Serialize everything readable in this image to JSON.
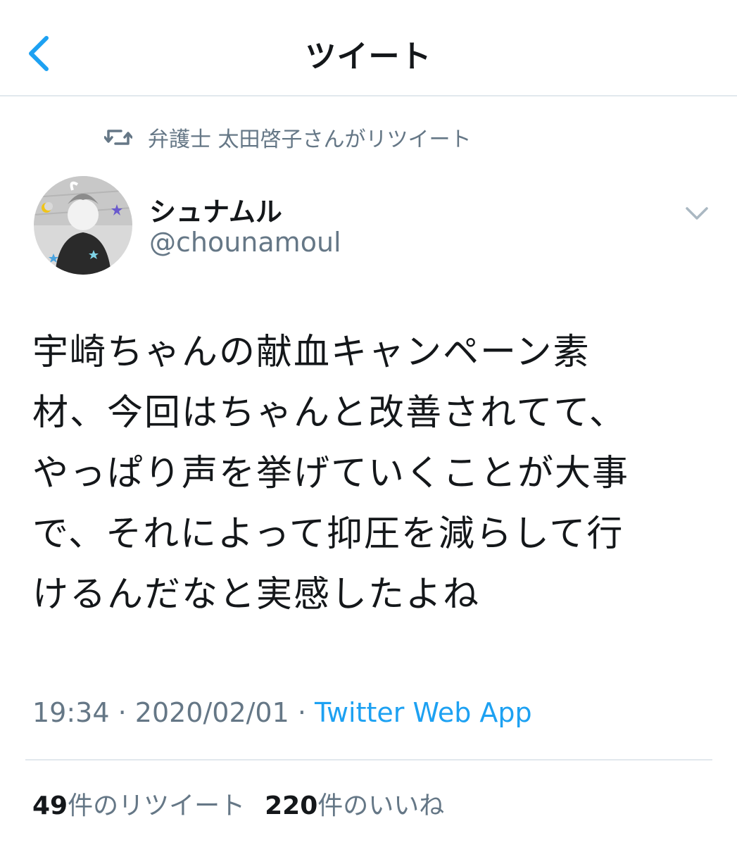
{
  "header": {
    "back_icon": "chevron-left-icon",
    "title": "ツイート"
  },
  "retweet_context": {
    "icon": "retweet-icon",
    "text": "弁護士 太田啓子さんがリツイート"
  },
  "author": {
    "display_name": "シュナムル",
    "handle": "@chounamoul",
    "avatar": "avatar-illustration"
  },
  "tweet": {
    "text": "宇崎ちゃんの献血キャンペーン素\n材、今回はちゃんと改善されてて、\nやっぱり声を挙げていくことが大事\nで、それによって抑圧を減らして行\nけるんだなと実感したよね",
    "time": "19:34",
    "separator": " · ",
    "date": "2020/02/01",
    "source": "Twitter Web App"
  },
  "stats": {
    "retweets_count": "49",
    "retweets_label": "件のリツイート",
    "likes_count": "220",
    "likes_label": "件のいいね"
  },
  "colors": {
    "accent": "#1da1f2",
    "secondary_text": "#657786",
    "primary_text": "#14171a",
    "divider": "#e1e8ed"
  }
}
